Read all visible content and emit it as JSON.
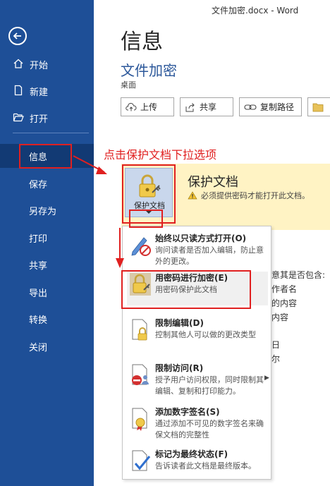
{
  "window": {
    "title": "文件加密.docx - Word"
  },
  "sidebar": {
    "items": [
      {
        "label": "开始",
        "icon": "home-icon"
      },
      {
        "label": "新建",
        "icon": "new-document-icon"
      },
      {
        "label": "打开",
        "icon": "open-folder-icon"
      },
      {
        "label": "信息"
      },
      {
        "label": "保存"
      },
      {
        "label": "另存为"
      },
      {
        "label": "打印"
      },
      {
        "label": "共享"
      },
      {
        "label": "导出"
      },
      {
        "label": "转换"
      },
      {
        "label": "关闭"
      }
    ],
    "active": "信息"
  },
  "main": {
    "title": "信息",
    "doc_name": "文件加密",
    "doc_path": "桌面",
    "buttons": [
      {
        "label": "上传",
        "icon": "upload-cloud-icon"
      },
      {
        "label": "共享",
        "icon": "share-icon"
      },
      {
        "label": "复制路径",
        "icon": "link-icon"
      }
    ],
    "protect": {
      "button_label": "保护文档",
      "title": "保护文档",
      "desc": "必须提供密码才能打开此文档。"
    },
    "background_texts": [
      "意其是否包含:",
      "作者名",
      "的内容",
      "内容",
      "日",
      "尔"
    ]
  },
  "annotation": {
    "text": "点击保护文档下拉选项",
    "color": "#e02020"
  },
  "menu": {
    "items": [
      {
        "title": "始终以只读方式打开(O)",
        "desc": "询问读者是否加入编辑，防止意外的更改。",
        "icon": "pencil-no-edit-icon"
      },
      {
        "title": "用密码进行加密(E)",
        "desc": "用密码保护此文档",
        "icon": "lock-key-icon",
        "highlighted": true
      },
      {
        "title": "限制编辑(D)",
        "desc": "控制其他人可以做的更改类型",
        "icon": "document-lock-icon"
      },
      {
        "title": "限制访问(R)",
        "desc": "授予用户访问权限，同时限制其编辑、复制和打印能力。",
        "icon": "restrict-access-icon",
        "submenu": true
      },
      {
        "title": "添加数字签名(S)",
        "desc": "通过添加不可见的数字签名来确保文档的完整性",
        "icon": "signature-ribbon-icon"
      },
      {
        "title": "标记为最终状态(F)",
        "desc": "告诉读者此文档是最终版本。",
        "icon": "final-checkmark-icon"
      }
    ]
  },
  "colors": {
    "sidebar": "#1e4f97",
    "sidebar_active": "#123a74",
    "accent": "#2b579a",
    "annotation": "#e02020",
    "banner": "#fff3c4"
  }
}
